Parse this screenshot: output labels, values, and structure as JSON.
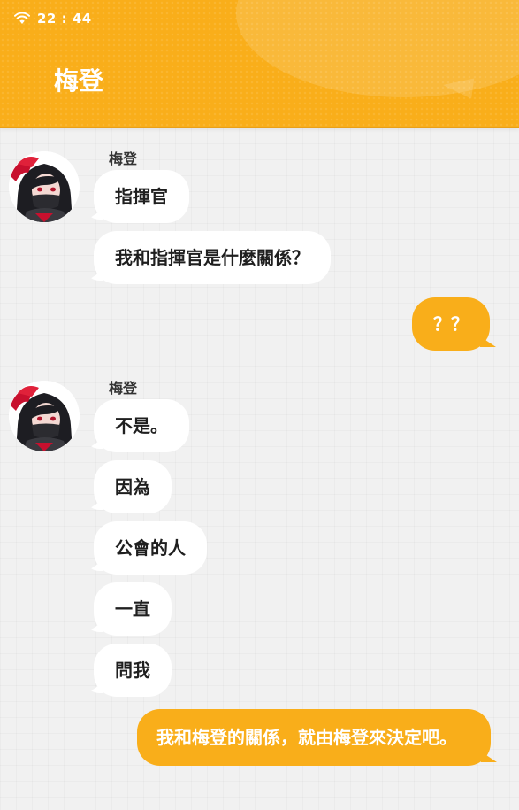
{
  "status_bar": {
    "time": "22 : 44"
  },
  "header": {
    "title": "梅登"
  },
  "groups": [
    {
      "sender": "梅登",
      "messages": [
        "指揮官",
        "我和指揮官是什麼關係？"
      ]
    },
    {
      "sender": "梅登",
      "messages": [
        "不是。",
        "因為",
        "公會的人",
        "一直",
        "問我"
      ]
    }
  ],
  "outgoing": [
    "？？",
    "我和梅登的關係，就由梅登來決定吧。"
  ],
  "colors": {
    "accent": "#f9ae1a",
    "incoming_bubble": "#ffffff",
    "background": "#f1f1f1"
  }
}
